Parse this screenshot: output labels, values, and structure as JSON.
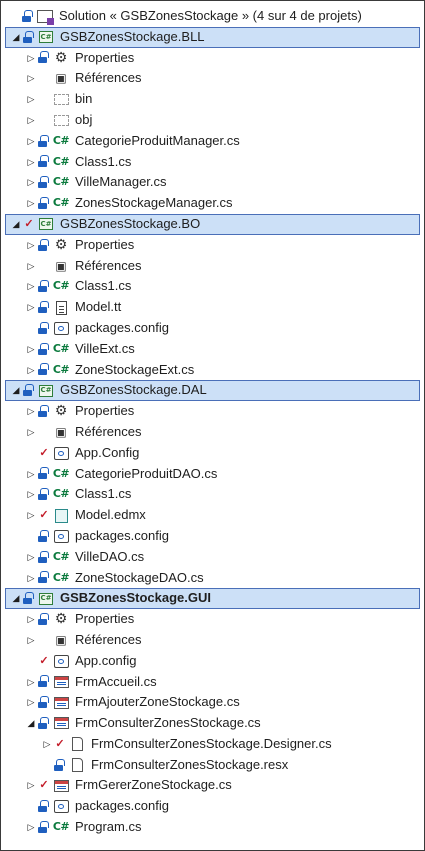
{
  "solution_label": "Solution « GSBZonesStockage » (4 sur 4 de projets)",
  "rows": [
    {
      "indent": 0,
      "exp": "",
      "st": "lock",
      "icon": "solution",
      "label": "Solution « GSBZonesStockage » (4 sur 4 de projets)",
      "type": "solution"
    },
    {
      "indent": 0,
      "exp": "open",
      "st": "lock",
      "icon": "project",
      "label": "GSBZonesStockage.BLL",
      "type": "project"
    },
    {
      "indent": 1,
      "exp": "closed",
      "st": "lock",
      "icon": "wrench",
      "label": "Properties"
    },
    {
      "indent": 1,
      "exp": "closed",
      "st": "",
      "icon": "references",
      "label": "Références"
    },
    {
      "indent": 1,
      "exp": "closed",
      "st": "",
      "icon": "folder",
      "label": "bin"
    },
    {
      "indent": 1,
      "exp": "closed",
      "st": "",
      "icon": "folder",
      "label": "obj"
    },
    {
      "indent": 1,
      "exp": "closed",
      "st": "lock",
      "icon": "cs",
      "label": "CategorieProduitManager.cs"
    },
    {
      "indent": 1,
      "exp": "closed",
      "st": "lock",
      "icon": "cs",
      "label": "Class1.cs"
    },
    {
      "indent": 1,
      "exp": "closed",
      "st": "lock",
      "icon": "cs",
      "label": "VilleManager.cs"
    },
    {
      "indent": 1,
      "exp": "closed",
      "st": "lock",
      "icon": "cs",
      "label": "ZonesStockageManager.cs"
    },
    {
      "indent": 0,
      "exp": "open",
      "st": "check",
      "icon": "project",
      "label": "GSBZonesStockage.BO",
      "type": "project"
    },
    {
      "indent": 1,
      "exp": "closed",
      "st": "lock",
      "icon": "wrench",
      "label": "Properties"
    },
    {
      "indent": 1,
      "exp": "closed",
      "st": "",
      "icon": "references",
      "label": "Références"
    },
    {
      "indent": 1,
      "exp": "closed",
      "st": "lock",
      "icon": "cs",
      "label": "Class1.cs"
    },
    {
      "indent": 1,
      "exp": "closed",
      "st": "lock",
      "icon": "file",
      "label": "Model.tt"
    },
    {
      "indent": 1,
      "exp": "",
      "st": "lock",
      "icon": "config",
      "label": "packages.config"
    },
    {
      "indent": 1,
      "exp": "closed",
      "st": "lock",
      "icon": "cs",
      "label": "VilleExt.cs"
    },
    {
      "indent": 1,
      "exp": "closed",
      "st": "lock",
      "icon": "cs",
      "label": "ZoneStockageExt.cs"
    },
    {
      "indent": 0,
      "exp": "open",
      "st": "lock",
      "icon": "project",
      "label": "GSBZonesStockage.DAL",
      "type": "project"
    },
    {
      "indent": 1,
      "exp": "closed",
      "st": "lock",
      "icon": "wrench",
      "label": "Properties"
    },
    {
      "indent": 1,
      "exp": "closed",
      "st": "",
      "icon": "references",
      "label": "Références"
    },
    {
      "indent": 1,
      "exp": "",
      "st": "check",
      "icon": "config",
      "label": "App.Config"
    },
    {
      "indent": 1,
      "exp": "closed",
      "st": "lock",
      "icon": "cs",
      "label": "CategorieProduitDAO.cs"
    },
    {
      "indent": 1,
      "exp": "closed",
      "st": "lock",
      "icon": "cs",
      "label": "Class1.cs"
    },
    {
      "indent": 1,
      "exp": "closed",
      "st": "check",
      "icon": "edmx",
      "label": "Model.edmx"
    },
    {
      "indent": 1,
      "exp": "",
      "st": "lock",
      "icon": "config",
      "label": "packages.config"
    },
    {
      "indent": 1,
      "exp": "closed",
      "st": "lock",
      "icon": "cs",
      "label": "VilleDAO.cs"
    },
    {
      "indent": 1,
      "exp": "closed",
      "st": "lock",
      "icon": "cs",
      "label": "ZoneStockageDAO.cs"
    },
    {
      "indent": 0,
      "exp": "open",
      "st": "lock",
      "icon": "project",
      "label": "GSBZonesStockage.GUI",
      "type": "project",
      "bold": true
    },
    {
      "indent": 1,
      "exp": "closed",
      "st": "lock",
      "icon": "wrench",
      "label": "Properties"
    },
    {
      "indent": 1,
      "exp": "closed",
      "st": "",
      "icon": "references",
      "label": "Références"
    },
    {
      "indent": 1,
      "exp": "",
      "st": "check",
      "icon": "config",
      "label": "App.config"
    },
    {
      "indent": 1,
      "exp": "closed",
      "st": "lock",
      "icon": "form",
      "label": "FrmAccueil.cs"
    },
    {
      "indent": 1,
      "exp": "closed",
      "st": "lock",
      "icon": "form",
      "label": "FrmAjouterZoneStockage.cs"
    },
    {
      "indent": 1,
      "exp": "open",
      "st": "lock",
      "icon": "form",
      "label": "FrmConsulterZonesStockage.cs"
    },
    {
      "indent": 2,
      "exp": "closed",
      "st": "check",
      "icon": "resx",
      "label": "FrmConsulterZonesStockage.Designer.cs"
    },
    {
      "indent": 2,
      "exp": "",
      "st": "lock",
      "icon": "resx",
      "label": "FrmConsulterZonesStockage.resx"
    },
    {
      "indent": 1,
      "exp": "closed",
      "st": "check",
      "icon": "form",
      "label": "FrmGererZoneStockage.cs"
    },
    {
      "indent": 1,
      "exp": "",
      "st": "lock",
      "icon": "config",
      "label": "packages.config"
    },
    {
      "indent": 1,
      "exp": "closed",
      "st": "lock",
      "icon": "cs",
      "label": "Program.cs"
    }
  ]
}
